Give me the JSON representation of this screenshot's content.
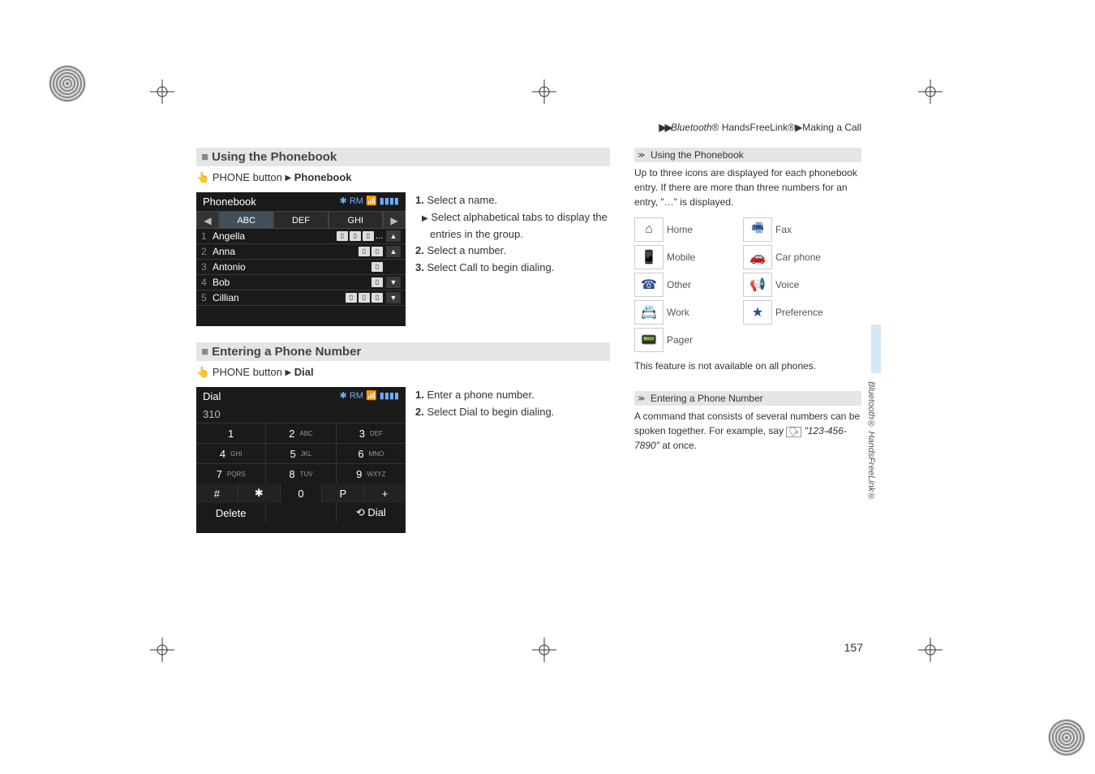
{
  "breadcrumb": {
    "arrows": "▶▶",
    "path1_italic": "Bluetooth",
    "path1_rest": "® HandsFreeLink®",
    "sep": "▶",
    "path2": "Making a Call"
  },
  "section1": {
    "heading": "Using the Phonebook",
    "nav_prefix": "PHONE button",
    "nav_tri": "▶",
    "nav_bold": "Phonebook",
    "screenshot": {
      "title": "Phonebook",
      "status": "RM",
      "tabs_left": "◀",
      "tabs": [
        "ABC",
        "DEF",
        "GHI"
      ],
      "tabs_right": "▶",
      "rows": [
        {
          "idx": "1",
          "name": "Angella",
          "icons": 3,
          "ellipsis": "...",
          "btn": "▲"
        },
        {
          "idx": "2",
          "name": "Anna",
          "icons": 2,
          "btn": "▲"
        },
        {
          "idx": "3",
          "name": "Antonio",
          "icons": 1
        },
        {
          "idx": "4",
          "name": "Bob",
          "icons": 1,
          "btn": "▼"
        },
        {
          "idx": "5",
          "name": "Cillian",
          "icons": 3,
          "btn": "▼"
        }
      ]
    },
    "steps": [
      {
        "n": "1.",
        "text": "Select a name."
      },
      {
        "sub": true,
        "text": "Select alphabetical tabs to display the entries in the group."
      },
      {
        "n": "2.",
        "text": "Select a number."
      },
      {
        "n": "3.",
        "pre": "Select ",
        "bold": "Call",
        "post": " to begin dialing."
      }
    ]
  },
  "section2": {
    "heading": "Entering a Phone Number",
    "nav_prefix": "PHONE button",
    "nav_tri": "▶",
    "nav_bold": "Dial",
    "screenshot": {
      "title": "Dial",
      "input": "310",
      "keys": [
        [
          "1",
          ""
        ],
        [
          "2",
          "ABC"
        ],
        [
          "3",
          "DEF"
        ],
        [
          "4",
          "GHI"
        ],
        [
          "5",
          "JKL"
        ],
        [
          "6",
          "MNO"
        ],
        [
          "7",
          "PQRS"
        ],
        [
          "8",
          "TUV"
        ],
        [
          "9",
          "WXYZ"
        ]
      ],
      "bottom_row": [
        "#",
        "✱",
        "0",
        "P",
        "+"
      ],
      "footer": [
        "Delete",
        "",
        "⟲   Dial"
      ]
    },
    "steps": [
      {
        "n": "1.",
        "text": "Enter a phone number."
      },
      {
        "n": "2.",
        "pre": "Select ",
        "bold": "Dial",
        "post": " to begin dialing."
      }
    ]
  },
  "sidebar": {
    "head1": "Using the Phonebook",
    "text1": "Up to three icons are displayed for each phonebook entry. If there are more than three numbers for an entry, \"…\" is displayed.",
    "icons": [
      {
        "glyph": "⌂",
        "label": "Home",
        "glyph2": "🖷",
        "label2": "Fax"
      },
      {
        "glyph": "📱",
        "label": "Mobile",
        "glyph2": "🚗",
        "label2": "Car phone"
      },
      {
        "glyph": "☎",
        "label": "Other",
        "glyph2": "📢",
        "label2": "Voice"
      },
      {
        "glyph": "📇",
        "label": "Work",
        "glyph2": "★",
        "label2": "Preference"
      },
      {
        "glyph": "📟",
        "label": "Pager"
      }
    ],
    "footnote1": "This feature is not available on all phones.",
    "head2": "Entering a Phone Number",
    "text2_pre": "A command that consists of several numbers can be spoken together. For example, say ",
    "text2_italic": "\"123-456-7890\"",
    "text2_post": " at once."
  },
  "vertical": "Bluetooth® HandsFreeLink®",
  "page_num": "157"
}
